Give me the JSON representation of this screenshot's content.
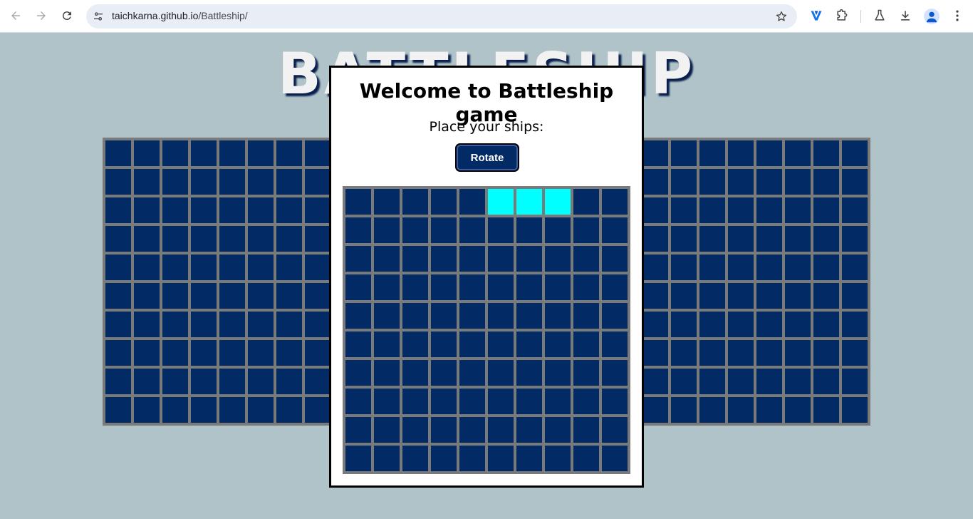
{
  "browser": {
    "url_host": "taichkarna.github.io",
    "url_path": "/Battleship/",
    "icons": [
      "back-icon",
      "forward-icon",
      "reload-icon",
      "site-info-icon",
      "bookmark-star-icon",
      "extension-shield-icon",
      "extensions-puzzle-icon",
      "labs-flask-icon",
      "download-icon",
      "profile-icon",
      "menu-kebab-icon"
    ]
  },
  "page": {
    "background_title": "BATTLESHIP",
    "board_rows": 10,
    "board_cols": 10
  },
  "modal": {
    "title": "Welcome to Battleship game",
    "subtitle": "Place your ships:",
    "rotate_label": "Rotate",
    "ship_preview_cells": [
      [
        0,
        5
      ],
      [
        0,
        6
      ],
      [
        0,
        7
      ]
    ]
  },
  "colors": {
    "page_bg": "#afc3c9",
    "cell": "#022b66",
    "grid_line": "#7a7a7a",
    "ship": "#00ffff"
  }
}
